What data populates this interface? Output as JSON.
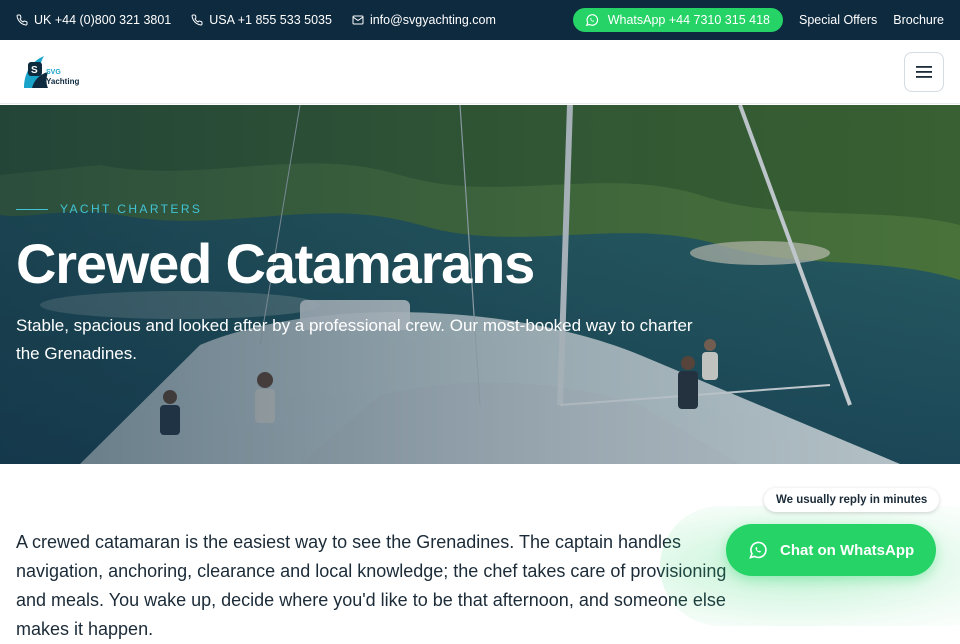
{
  "topbar": {
    "uk_phone": "UK +44 (0)800 321 3801",
    "usa_phone": "USA +1 855 533 5035",
    "email": "info@svgyachting.com",
    "whatsapp": "WhatsApp +44 7310 315 418",
    "special_offers": "Special Offers",
    "brochure": "Brochure"
  },
  "header": {
    "logo_word_top": "SVG",
    "logo_word_bottom": "Yachting"
  },
  "hero": {
    "eyebrow": "YACHT CHARTERS",
    "title": "Crewed Catamarans",
    "subtitle": "Stable, spacious and looked after by a professional crew. Our most-booked way to charter the Grenadines."
  },
  "intro": {
    "text": "A crewed catamaran is the easiest way to see the Grenadines. The captain handles navigation, anchoring, clearance and local knowledge; the chef takes care of provisioning and meals. You wake up, decide where you'd like to be that afternoon, and someone else makes it happen."
  },
  "chat": {
    "reply_note": "We usually reply in minutes",
    "button": "Chat on WhatsApp"
  },
  "colors": {
    "topbar_bg": "#0e2a3f",
    "whatsapp_green": "#25d366",
    "accent_teal": "#41c4d6"
  },
  "icons": {
    "phone": "phone-icon",
    "email": "mail-icon",
    "whatsapp": "whatsapp-icon",
    "menu": "hamburger-menu-icon"
  }
}
